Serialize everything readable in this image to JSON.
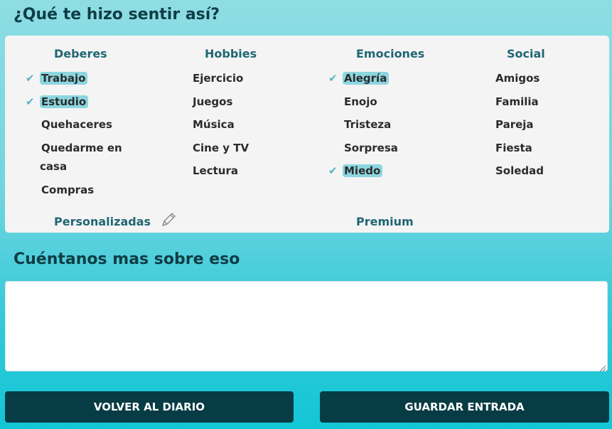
{
  "question": "¿Qué te hizo sentir así?",
  "categories": [
    {
      "title": "Deberes",
      "items": [
        {
          "label": "Trabajo",
          "selected": true
        },
        {
          "label": "Estudio",
          "selected": true
        },
        {
          "label": "Quehaceres",
          "selected": false
        },
        {
          "label": "Quedarme en casa",
          "selected": false
        },
        {
          "label": "Compras",
          "selected": false
        }
      ]
    },
    {
      "title": "Hobbies",
      "items": [
        {
          "label": "Ejercicio",
          "selected": false
        },
        {
          "label": "Juegos",
          "selected": false
        },
        {
          "label": "Música",
          "selected": false
        },
        {
          "label": "Cine y TV",
          "selected": false
        },
        {
          "label": "Lectura",
          "selected": false
        }
      ]
    },
    {
      "title": "Emociones",
      "items": [
        {
          "label": "Alegría",
          "selected": true
        },
        {
          "label": "Enojo",
          "selected": false
        },
        {
          "label": "Tristeza",
          "selected": false
        },
        {
          "label": "Sorpresa",
          "selected": false
        },
        {
          "label": "Miedo",
          "selected": true
        }
      ]
    },
    {
      "title": "Social",
      "items": [
        {
          "label": "Amigos",
          "selected": false
        },
        {
          "label": "Familia",
          "selected": false
        },
        {
          "label": "Pareja",
          "selected": false
        },
        {
          "label": "Fiesta",
          "selected": false
        },
        {
          "label": "Soledad",
          "selected": false
        }
      ]
    }
  ],
  "custom": {
    "title": "Personalizadas",
    "icon": "pencil-icon"
  },
  "premium": {
    "title": "Premium"
  },
  "check_icon": "check-icon",
  "tell_more": "Cuéntanos mas sobre eso",
  "notes": {
    "value": ""
  },
  "buttons": {
    "back": "VOLVER AL DIARIO",
    "save": "GUARDAR ENTRADA"
  },
  "colors": {
    "dark": "#083c44",
    "title_teal": "#1f6673",
    "highlight": "#8cd6e0",
    "check": "#59b5c6"
  }
}
